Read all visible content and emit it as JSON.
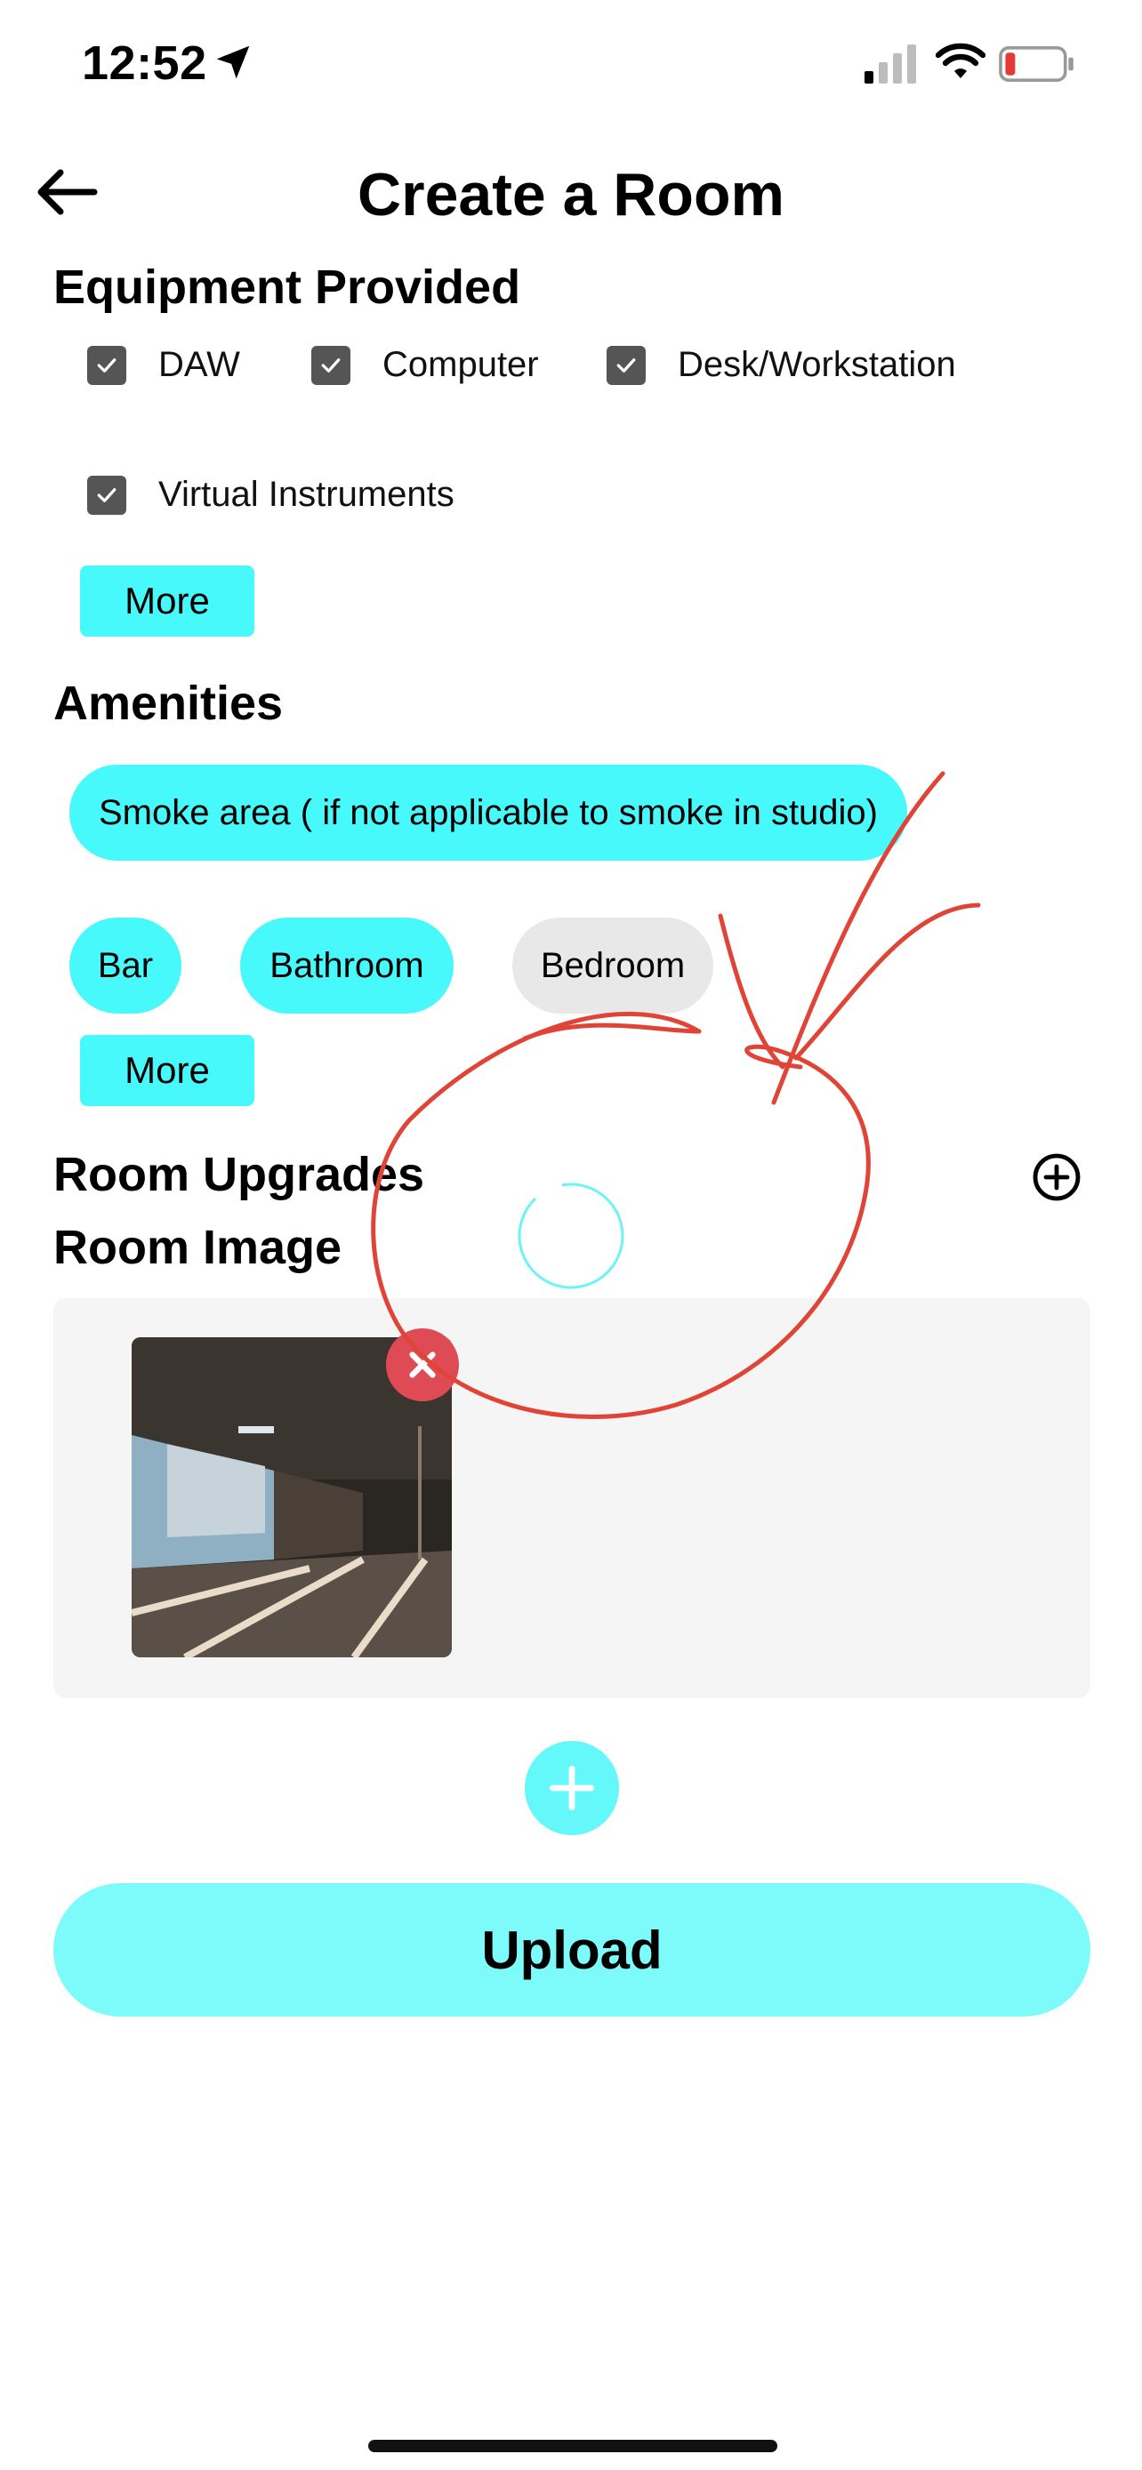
{
  "status_bar": {
    "time": "12:52"
  },
  "header": {
    "title": "Create a Room"
  },
  "equipment": {
    "title": "Equipment Provided",
    "items": [
      {
        "label": "DAW",
        "checked": true
      },
      {
        "label": "Computer",
        "checked": true
      },
      {
        "label": "Desk/Workstation",
        "checked": true
      },
      {
        "label": "Virtual Instruments",
        "checked": true
      }
    ],
    "more_label": "More"
  },
  "amenities": {
    "title": "Amenities",
    "chips": [
      {
        "label": "Smoke area ( if not applicable to smoke in studio)",
        "selected": true
      },
      {
        "label": "Bar",
        "selected": true
      },
      {
        "label": "Bathroom",
        "selected": true
      },
      {
        "label": "Bedroom",
        "selected": false
      }
    ],
    "more_label": "More"
  },
  "room_upgrades": {
    "title": "Room Upgrades"
  },
  "room_image": {
    "title": "Room Image"
  },
  "upload_label": "Upload",
  "colors": {
    "accent": "#47f9fb",
    "upload_bg": "#7dfbfb",
    "chip_off": "#e8e8e8",
    "remove": "#df4b55",
    "annotation": "#e04436"
  }
}
